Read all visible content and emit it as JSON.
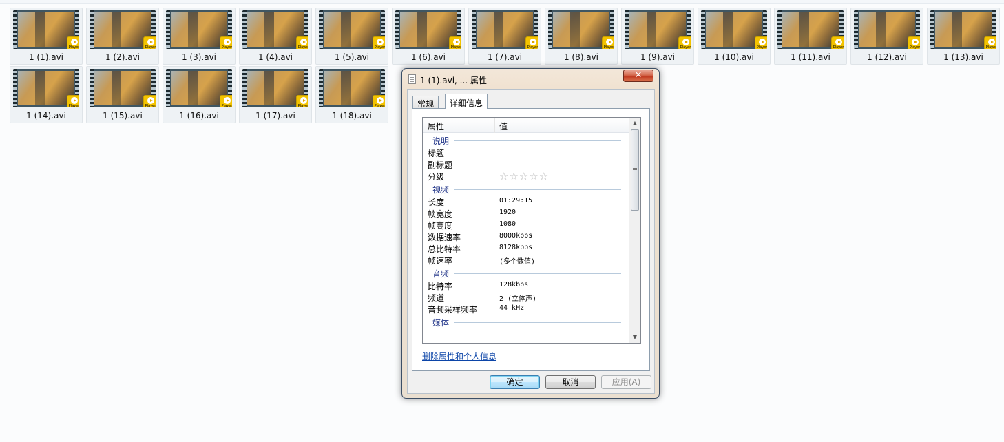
{
  "files": [
    {
      "name": "1 (1).avi"
    },
    {
      "name": "1 (2).avi"
    },
    {
      "name": "1 (3).avi"
    },
    {
      "name": "1 (4).avi"
    },
    {
      "name": "1 (5).avi"
    },
    {
      "name": "1 (6).avi"
    },
    {
      "name": "1 (7).avi"
    },
    {
      "name": "1 (8).avi"
    },
    {
      "name": "1 (9).avi"
    },
    {
      "name": "1 (10).avi"
    },
    {
      "name": "1 (11).avi"
    },
    {
      "name": "1 (12).avi"
    },
    {
      "name": "1 (13).avi"
    },
    {
      "name": "1 (14).avi"
    },
    {
      "name": "1 (15).avi"
    },
    {
      "name": "1 (16).avi"
    },
    {
      "name": "1 (17).avi"
    },
    {
      "name": "1 (18).avi"
    }
  ],
  "badge_text": "Player",
  "dialog": {
    "title": "1 (1).avi, ... 属性",
    "close_glyph": "✕",
    "tabs": {
      "general": "常规",
      "details": "详细信息"
    },
    "columns": {
      "property": "属性",
      "value": "值"
    },
    "groups": {
      "description": {
        "title": "说明",
        "rows": [
          {
            "key": "标题",
            "value": ""
          },
          {
            "key": "副标题",
            "value": ""
          }
        ],
        "rating_label": "分级",
        "rating_stars": 0,
        "rating_max": 5
      },
      "video": {
        "title": "视频",
        "rows": [
          {
            "key": "长度",
            "value": "01:29:15"
          },
          {
            "key": "帧宽度",
            "value": "1920"
          },
          {
            "key": "帧高度",
            "value": "1080"
          },
          {
            "key": "数据速率",
            "value": "8000kbps"
          },
          {
            "key": "总比特率",
            "value": "8128kbps"
          },
          {
            "key": "帧速率",
            "value": "(多个数值)"
          }
        ]
      },
      "audio": {
        "title": "音频",
        "rows": [
          {
            "key": "比特率",
            "value": "128kbps"
          },
          {
            "key": "频道",
            "value": "2 (立体声)"
          },
          {
            "key": "音频采样频率",
            "value": "44 kHz"
          }
        ]
      },
      "media": {
        "title": "媒体"
      }
    },
    "remove_link": "删除属性和个人信息",
    "buttons": {
      "ok": "确定",
      "cancel": "取消",
      "apply": "应用(A)"
    }
  }
}
